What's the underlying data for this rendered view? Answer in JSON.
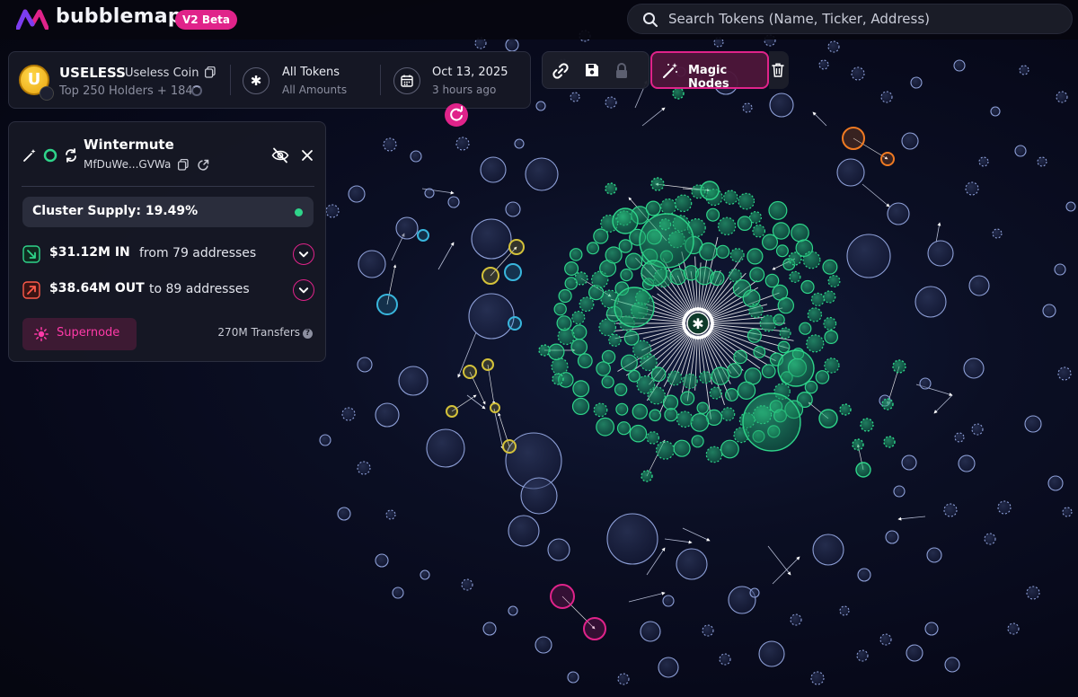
{
  "app": {
    "brand": "bubblemaps",
    "version_badge": "V2 Beta"
  },
  "search": {
    "placeholder": "Search Tokens (Name, Ticker, Address)"
  },
  "token": {
    "ticker": "USELESS",
    "name": "Useless Coin",
    "logo_letter": "U",
    "holders_summary": "Top 250 Holders + 184"
  },
  "filters": {
    "tokens_label": "All Tokens",
    "amounts_label": "All Amounts"
  },
  "snapshot": {
    "date": "Oct 13, 2025",
    "relative": "3 hours ago"
  },
  "toolbar": {
    "magic_nodes_label": "Magic Nodes",
    "icons": [
      "link-icon",
      "save-icon",
      "lock-icon",
      "magic-wand-icon",
      "trash-icon"
    ]
  },
  "cluster": {
    "title": "Wintermute",
    "address": "MfDuWe...GVWa",
    "supply_label": "Cluster Supply: 19.49%",
    "inflow_amount": "$31.12M IN",
    "inflow_desc": "from 79 addresses",
    "outflow_amount": "$38.64M OUT",
    "outflow_desc": "to 89 addresses",
    "supernode_label": "Supernode",
    "transfers_label": "270M Transfers"
  },
  "colors": {
    "accent": "#e0238a",
    "cluster_green": "#2fd48a",
    "node_default": "#8ea0d8",
    "node_cyan": "#39b6dd",
    "node_yellow": "#d4c23a",
    "node_orange": "#f07a22",
    "node_magenta": "#e0238a",
    "background": "#07091a"
  }
}
